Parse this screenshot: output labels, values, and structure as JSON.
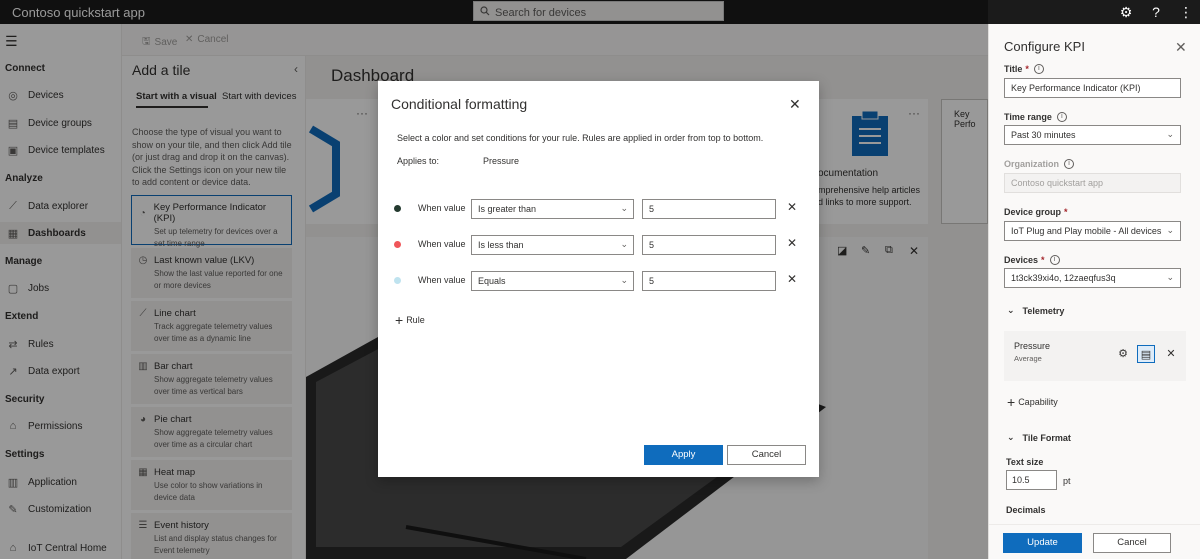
{
  "topbar": {
    "app_title": "Contoso quickstart app",
    "search_placeholder": "Search for devices"
  },
  "nav": {
    "sections": {
      "connect": "Connect",
      "analyze": "Analyze",
      "manage": "Manage",
      "extend": "Extend",
      "security": "Security",
      "settings": "Settings"
    },
    "items": {
      "devices": "Devices",
      "device_groups": "Device groups",
      "device_templates": "Device templates",
      "data_explorer": "Data explorer",
      "dashboards": "Dashboards",
      "jobs": "Jobs",
      "rules": "Rules",
      "data_export": "Data export",
      "permissions": "Permissions",
      "application": "Application",
      "customization": "Customization",
      "iot_central_home": "IoT Central Home"
    }
  },
  "toolbar": {
    "save_label": "Save",
    "cancel_label": "Cancel"
  },
  "tile_panel": {
    "title": "Add a tile",
    "tabs": [
      "Start with a visual",
      "Start with devices"
    ],
    "description": "Choose the type of visual you want to show on your tile, and then click Add tile (or just drag and drop it on the canvas). Click the Settings icon on your new tile to add content or device data.",
    "tiles": [
      {
        "title": "Key Performance Indicator (KPI)",
        "desc": "Set up telemetry for devices over a set time range"
      },
      {
        "title": "Last known value (LKV)",
        "desc": "Show the last value reported for one or more devices"
      },
      {
        "title": "Line chart",
        "desc": "Track aggregate telemetry values over time as a dynamic line"
      },
      {
        "title": "Bar chart",
        "desc": "Show aggregate telemetry values over time as vertical bars"
      },
      {
        "title": "Pie chart",
        "desc": "Show aggregate telemetry values over time as a circular chart"
      },
      {
        "title": "Heat map",
        "desc": "Use color to show variations in device data"
      },
      {
        "title": "Event history",
        "desc": "List and display status changes for Event telemetry"
      }
    ]
  },
  "dashboard": {
    "title": "Dashboard",
    "doc_card_title": "ocumentation",
    "doc_card_text1": "mprehensive help articles",
    "doc_card_text2": "d links to more support.",
    "kpi_card_title": "Key Perfo"
  },
  "dialog": {
    "title": "Conditional formatting",
    "subtitle": "Select a color and set conditions for your rule. Rules are applied in order from top to bottom.",
    "applies_to_label": "Applies to:",
    "applies_to_value": "Pressure",
    "rules": [
      {
        "color": "#243a2f",
        "label": "When value",
        "operator": "Is greater than",
        "value": "5"
      },
      {
        "color": "#f0565a",
        "label": "When value",
        "operator": "Is less than",
        "value": "5"
      },
      {
        "color": "#bfe3ef",
        "label": "When value",
        "operator": "Equals",
        "value": "5"
      }
    ],
    "add_rule_label": "Rule",
    "apply_label": "Apply",
    "cancel_label": "Cancel"
  },
  "config": {
    "title": "Configure KPI",
    "title_label": "Title",
    "title_value": "Key Performance Indicator (KPI)",
    "time_range_label": "Time range",
    "time_range_value": "Past 30 minutes",
    "organization_label": "Organization",
    "organization_value": "Contoso quickstart app",
    "device_group_label": "Device group",
    "device_group_value": "IoT Plug and Play mobile - All devices",
    "devices_label": "Devices",
    "devices_value": "1t3ck39xi4o, 12zaeqfus3q",
    "telemetry_section": "Telemetry",
    "telemetry_name": "Pressure",
    "telemetry_aggregation": "Average",
    "add_capability_label": "Capability",
    "tile_format_section": "Tile Format",
    "text_size_label": "Text size",
    "text_size_value": "10.5",
    "text_size_unit": "pt",
    "decimals_label": "Decimals",
    "update_label": "Update",
    "cancel_label": "Cancel"
  },
  "colors": {
    "accent": "#0f6cbd",
    "topbar_bg": "#1b1b1b",
    "required": "#a4262c"
  }
}
